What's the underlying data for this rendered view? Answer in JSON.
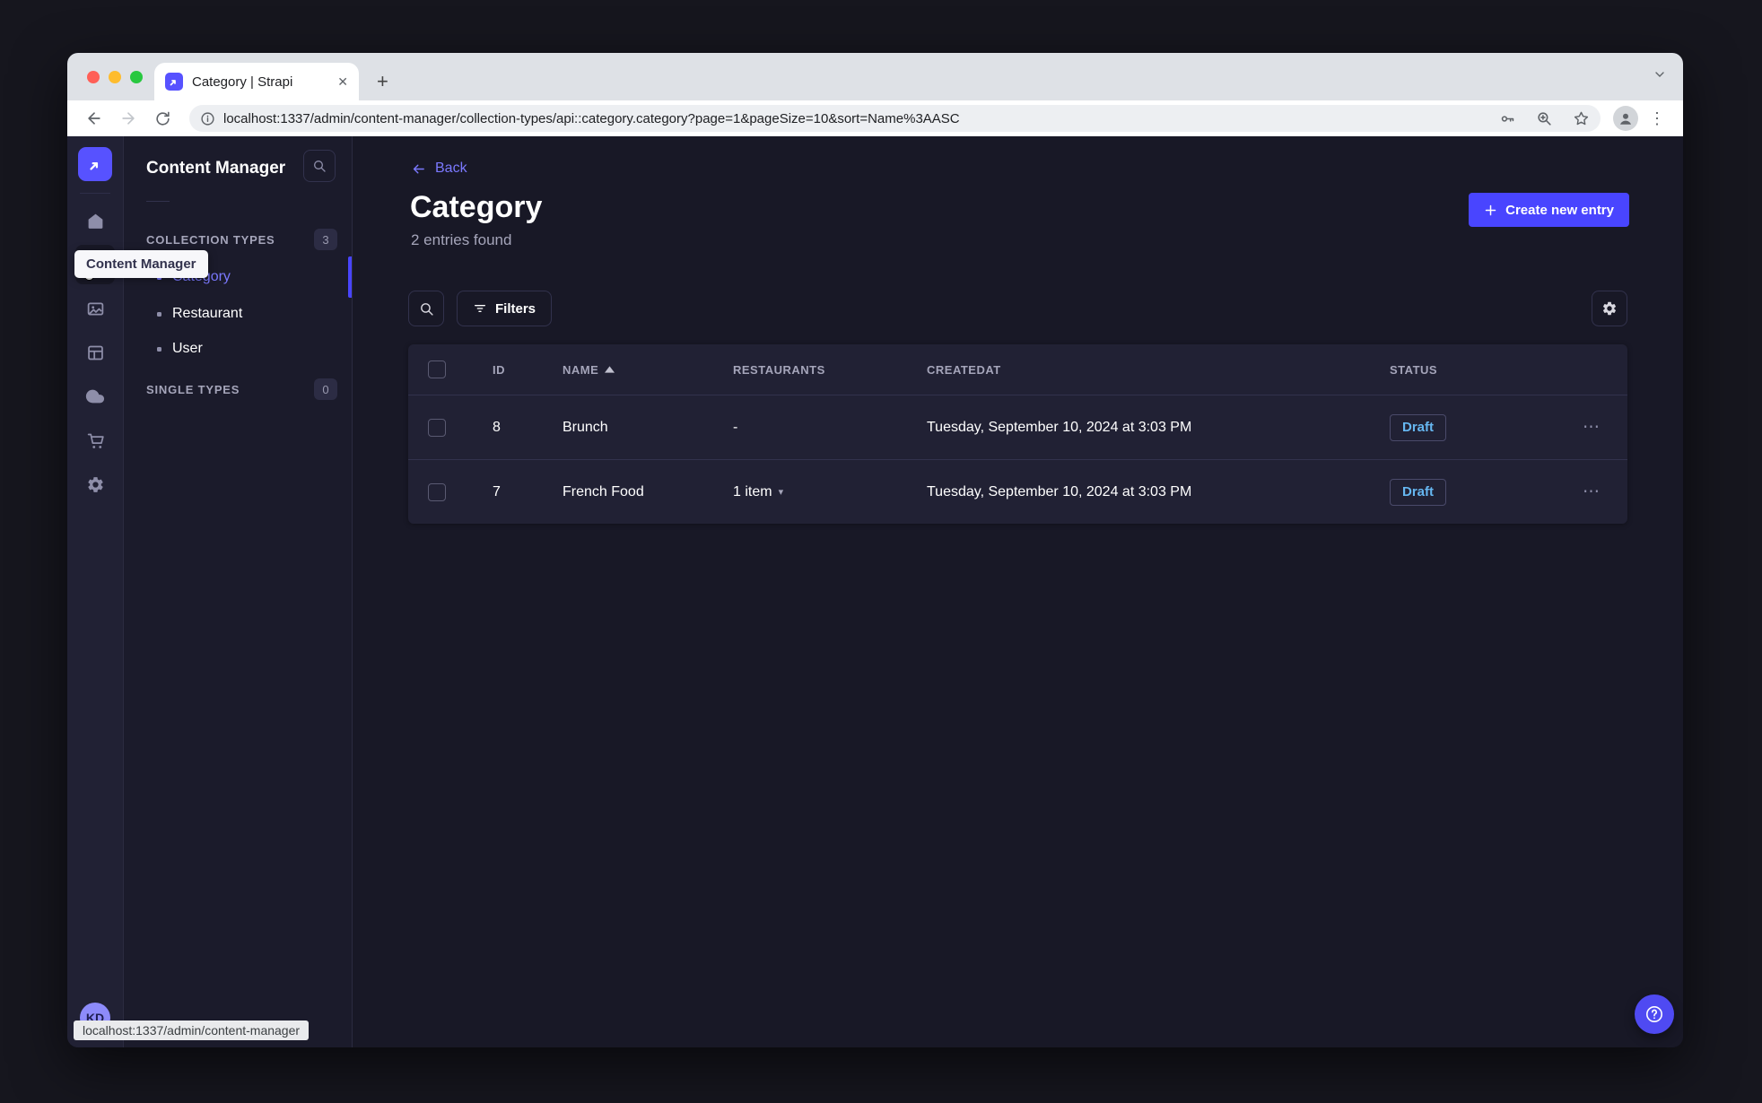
{
  "window": {
    "tab_title": "Category | Strapi",
    "url": "localhost:1337/admin/content-manager/collection-types/api::category.category?page=1&pageSize=10&sort=Name%3AASC",
    "status_bar": "localhost:1337/admin/content-manager"
  },
  "icons": {
    "close_tab": "✕",
    "new_tab": "+",
    "chevron_down": "⌄",
    "menu_dots": "⋮",
    "actions_dots": "⋯",
    "caret_down": "▾",
    "back_arrow": "←"
  },
  "sidebar": {
    "tooltip": "Content Manager",
    "user_initials": "KD"
  },
  "subnav": {
    "title": "Content Manager",
    "collection_types_label": "COLLECTION TYPES",
    "collection_types_count": "3",
    "items": [
      {
        "label": "Category",
        "active": true
      },
      {
        "label": "Restaurant",
        "active": false
      },
      {
        "label": "User",
        "active": false
      }
    ],
    "single_types_label": "SINGLE TYPES",
    "single_types_count": "0"
  },
  "content": {
    "back": "Back",
    "title": "Category",
    "subtitle": "2 entries found",
    "create_button": "Create new entry",
    "filters": "Filters",
    "table": {
      "headers": {
        "id": "ID",
        "name": "NAME",
        "restaurants": "RESTAURANTS",
        "createdat": "CREATEDAT",
        "status": "STATUS"
      },
      "rows": [
        {
          "id": "8",
          "name": "Brunch",
          "restaurants": "-",
          "createdat": "Tuesday, September 10, 2024 at 3:03 PM",
          "status": "Draft"
        },
        {
          "id": "7",
          "name": "French Food",
          "restaurants": "1 item",
          "createdat": "Tuesday, September 10, 2024 at 3:03 PM",
          "status": "Draft"
        }
      ]
    }
  },
  "colors": {
    "brand": "#4945ff",
    "link": "#7b79ff",
    "draft_text": "#66b7f1",
    "app_bg": "#181826",
    "surface": "#212134",
    "border": "#32324d",
    "muted_text": "#a5a5ba"
  }
}
